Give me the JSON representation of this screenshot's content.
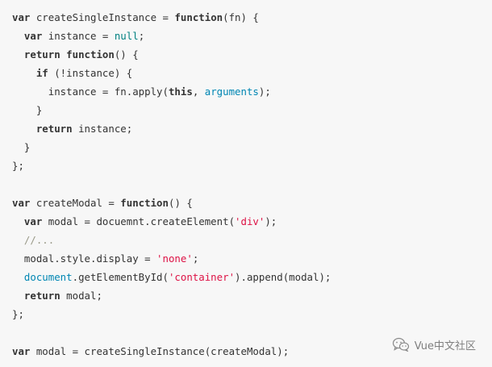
{
  "code": {
    "l1": {
      "a": "var",
      "b": " createSingleInstance = ",
      "c": "function",
      "d": "(fn) {"
    },
    "l2": {
      "a": "var",
      "b": " instance = ",
      "c": "null",
      "d": ";"
    },
    "l3": {
      "a": "return",
      "b": " ",
      "c": "function",
      "d": "() {"
    },
    "l4": {
      "a": "if",
      "b": " (!instance) {"
    },
    "l5": {
      "a": "instance = fn.apply(",
      "b": "this",
      "c": ", ",
      "d": "arguments",
      "e": ");"
    },
    "l6": {
      "a": "}"
    },
    "l7": {
      "a": "return",
      "b": " instance;"
    },
    "l8": {
      "a": "}"
    },
    "l9": {
      "a": "};"
    },
    "l10": {
      "a": "var",
      "b": " createModal = ",
      "c": "function",
      "d": "() {"
    },
    "l11": {
      "a": "var",
      "b": " modal = docuemnt.createElement(",
      "c": "'div'",
      "d": ");"
    },
    "l12": {
      "a": "//..."
    },
    "l13": {
      "a": "modal.style.display = ",
      "b": "'none'",
      "c": ";"
    },
    "l14": {
      "a": "document",
      "b": ".getElementById(",
      "c": "'container'",
      "d": ").append(modal);"
    },
    "l15": {
      "a": "return",
      "b": " modal;"
    },
    "l16": {
      "a": "};"
    },
    "l17": {
      "a": "var",
      "b": " modal = createSingleInstance(createModal);"
    }
  },
  "watermark": {
    "text": "Vue中文社区",
    "icon": "wechat-icon"
  }
}
